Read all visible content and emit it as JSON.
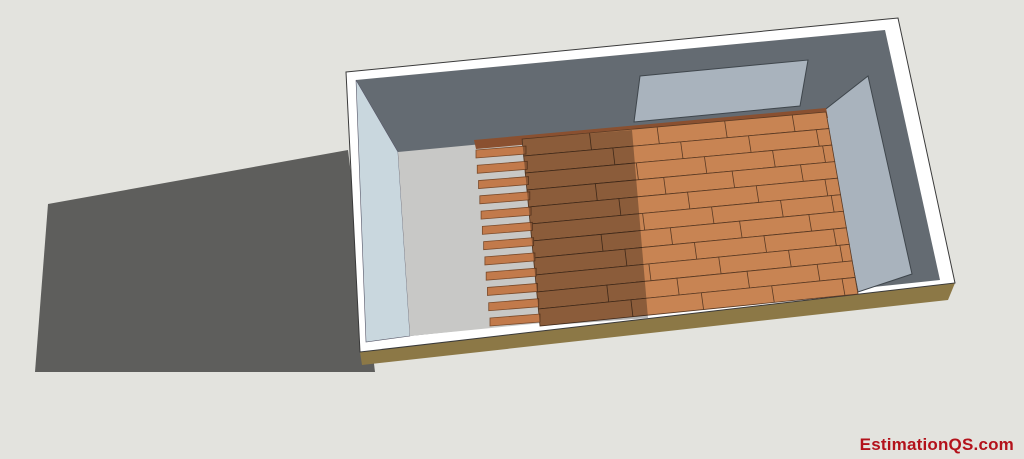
{
  "watermark": {
    "text": "EstimationQS.com",
    "color": "#b3121b"
  },
  "colors": {
    "background": "#e3e3de",
    "shadow": "#5e5e5c",
    "wall_outer_rim": "#ffffff",
    "wall_interior_back": "#646b72",
    "wall_interior_left": "#c9d7de",
    "wall_exterior_bottom": "#8c7846",
    "window": "#a9b3bd",
    "concrete_floor": "#c8c8c6",
    "plank_light": "#c88453",
    "plank_dark": "#8a5030",
    "joist": "#c27a4b"
  },
  "flooring": {
    "joist_count": 12,
    "plank_rows": 11
  }
}
